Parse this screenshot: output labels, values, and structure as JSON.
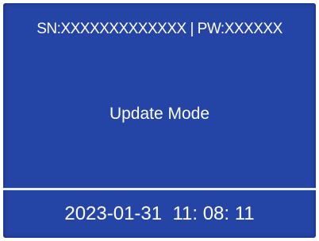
{
  "screen": {
    "credentials": "SN:XXXXXXXXXXXXX | PW:XXXXXX",
    "mode": "Update Mode",
    "datetime": "2023-01-31  11: 08: 11"
  },
  "colors": {
    "background": "#2444a6",
    "text": "#ffffff",
    "divider": "#e8eefc"
  }
}
